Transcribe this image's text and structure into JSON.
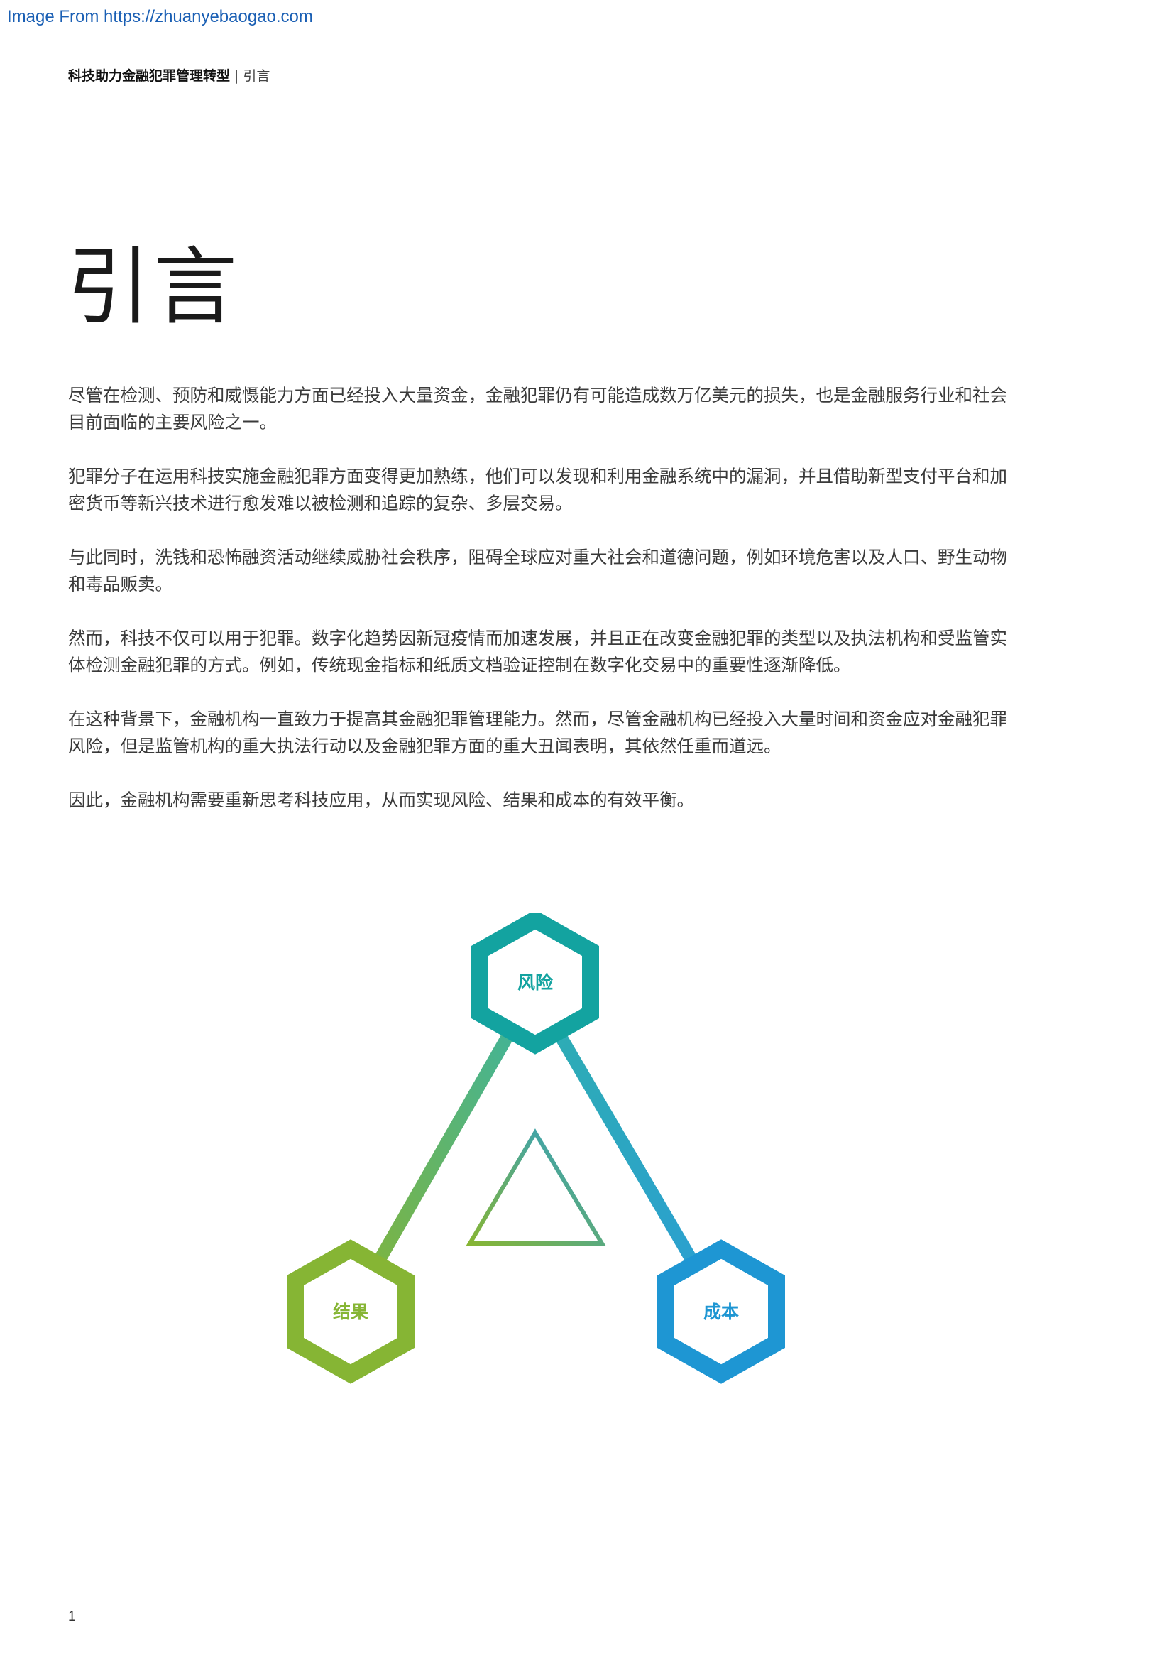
{
  "source_link": "Image From https://zhuanyebaogao.com",
  "header": {
    "doc_title": "科技助力金融犯罪管理转型",
    "separator": "|",
    "section": "引言"
  },
  "page_title": "引言",
  "paragraphs": [
    "尽管在检测、预防和威慑能力方面已经投入大量资金，金融犯罪仍有可能造成数万亿美元的损失，也是金融服务行业和社会目前面临的主要风险之一。",
    "犯罪分子在运用科技实施金融犯罪方面变得更加熟练，他们可以发现和利用金融系统中的漏洞，并且借助新型支付平台和加密货币等新兴技术进行愈发难以被检测和追踪的复杂、多层交易。",
    "与此同时，洗钱和恐怖融资活动继续威胁社会秩序，阻碍全球应对重大社会和道德问题，例如环境危害以及人口、野生动物和毒品贩卖。",
    "然而，科技不仅可以用于犯罪。数字化趋势因新冠疫情而加速发展，并且正在改变金融犯罪的类型以及执法机构和受监管实体检测金融犯罪的方式。例如，传统现金指标和纸质文档验证控制在数字化交易中的重要性逐渐降低。",
    "在这种背景下，金融机构一直致力于提高其金融犯罪管理能力。然而，尽管金融机构已经投入大量时间和资金应对金融犯罪风险，但是监管机构的重大执法行动以及金融犯罪方面的重大丑闻表明，其依然任重而道远。",
    "因此，金融机构需要重新思考科技应用，从而实现风险、结果和成本的有效平衡。"
  ],
  "diagram": {
    "nodes": [
      {
        "label": "风险",
        "color": "#13a3a0"
      },
      {
        "label": "结果",
        "color": "#86b534"
      },
      {
        "label": "成本",
        "color": "#1e96d3"
      }
    ],
    "center_color_start": "#86b534",
    "center_color_end": "#2e9fc8"
  },
  "page_number": "1"
}
